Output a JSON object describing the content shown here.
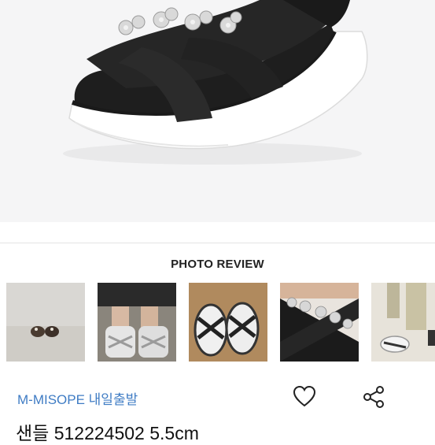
{
  "review": {
    "title": "PHOTO REVIEW",
    "thumbnails": [
      {
        "icon": "sandal-on-floor-photo"
      },
      {
        "icon": "white-sandal-on-feet-photo"
      },
      {
        "icon": "black-white-sandal-photo"
      },
      {
        "icon": "black-flower-sandal-photo"
      },
      {
        "icon": "white-sandals-in-hand-photo"
      }
    ]
  },
  "product": {
    "brand": "M-MISOPE 내일출발",
    "title": "샌들 512224502 5.5cm",
    "like_icon": "heart-icon",
    "share_icon": "share-icon"
  },
  "colors": {
    "brand_text": "#3f7cc4",
    "hero_bg": "#f5f5f6"
  }
}
